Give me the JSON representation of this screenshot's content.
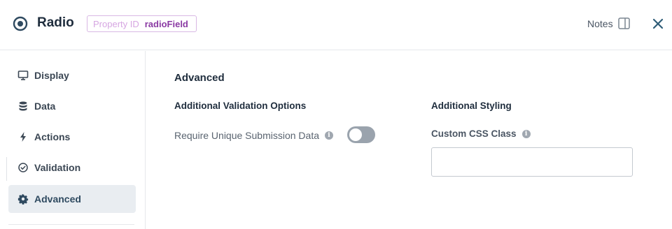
{
  "header": {
    "title": "Radio",
    "property_id_label": "Property ID",
    "property_id_value": "radioField",
    "notes_label": "Notes"
  },
  "sidebar": {
    "items": [
      {
        "label": "Display",
        "icon": "monitor-icon",
        "active": false
      },
      {
        "label": "Data",
        "icon": "database-icon",
        "active": false
      },
      {
        "label": "Actions",
        "icon": "lightning-icon",
        "active": false
      },
      {
        "label": "Validation",
        "icon": "check-circle-icon",
        "active": false
      },
      {
        "label": "Advanced",
        "icon": "gear-icon",
        "active": true
      }
    ]
  },
  "main": {
    "section_title": "Advanced",
    "validation": {
      "title": "Additional Validation Options",
      "require_unique_label": "Require Unique Submission Data",
      "require_unique_enabled": false
    },
    "styling": {
      "title": "Additional Styling",
      "css_class_label": "Custom CSS Class",
      "css_class_value": ""
    }
  },
  "colors": {
    "accent": "#2f4a60",
    "badge_border": "#d9b8e4",
    "badge_value": "#8a3aa3",
    "toggle_off": "#9aa3ad"
  }
}
